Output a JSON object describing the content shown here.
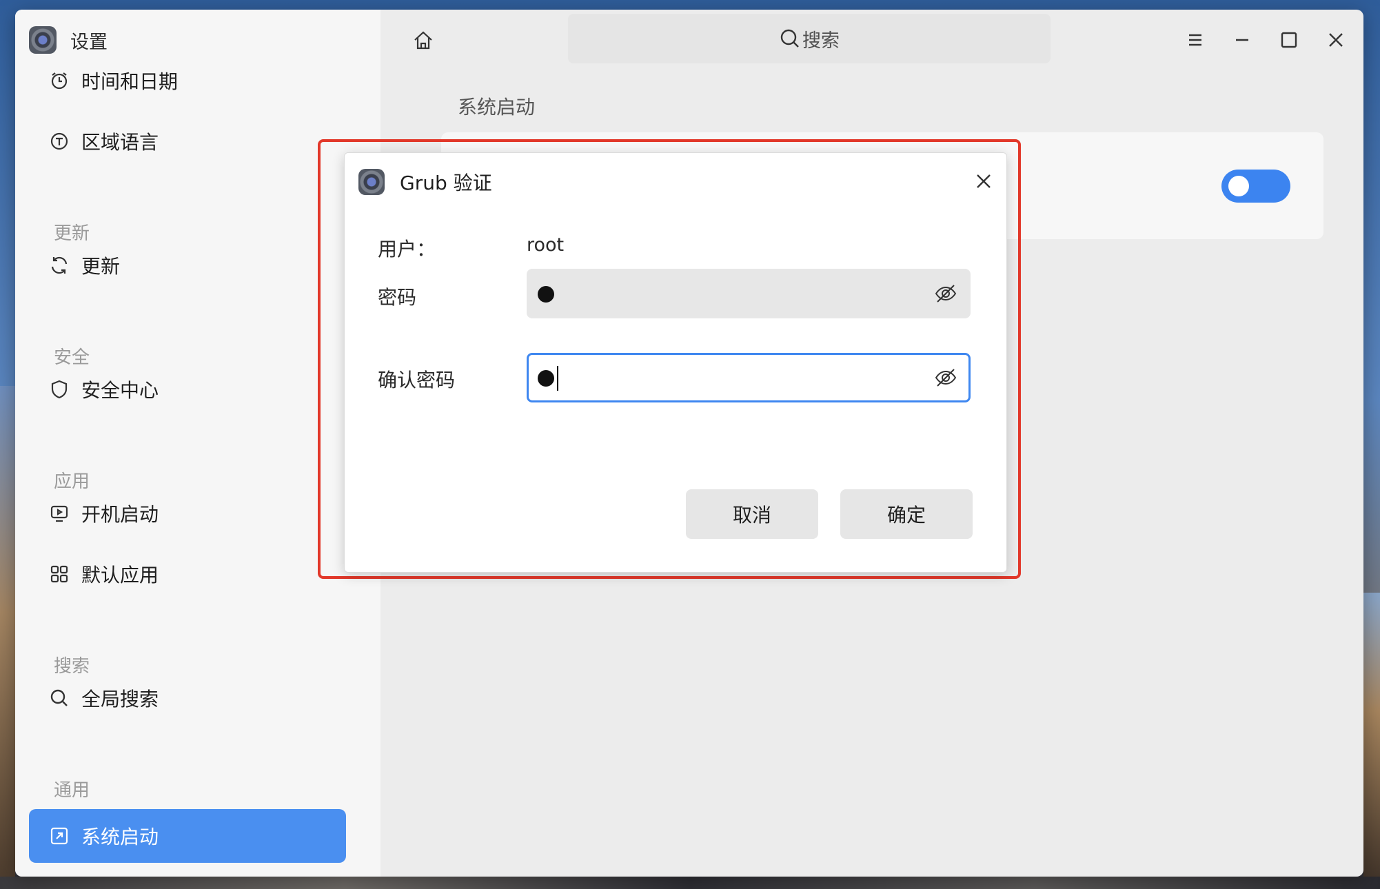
{
  "app": {
    "title": "设置"
  },
  "sidebar": {
    "items": [
      {
        "label": "时间和日期",
        "icon": "clock-icon"
      },
      {
        "label": "区域语言",
        "icon": "language-icon"
      },
      {
        "section": "更新"
      },
      {
        "label": "更新",
        "icon": "refresh-icon"
      },
      {
        "section": "安全"
      },
      {
        "label": "安全中心",
        "icon": "shield-icon"
      },
      {
        "section": "应用"
      },
      {
        "label": "开机启动",
        "icon": "autostart-icon"
      },
      {
        "label": "默认应用",
        "icon": "grid-icon"
      },
      {
        "section": "搜索"
      },
      {
        "label": "全局搜索",
        "icon": "search-icon"
      },
      {
        "section": "通用"
      },
      {
        "label": "系统启动",
        "icon": "boot-icon",
        "active": true
      }
    ]
  },
  "titlebar": {
    "search_placeholder": "搜索",
    "buttons": [
      "menu-icon",
      "minimize-icon",
      "maximize-icon",
      "close-icon"
    ]
  },
  "content": {
    "section_title": "系统启动",
    "toggle_on": true
  },
  "dialog": {
    "title": "Grub 验证",
    "user_label": "用户：",
    "user_value": "root",
    "password_label": "密码",
    "confirm_label": "确认密码",
    "cancel_label": "取消",
    "ok_label": "确定"
  },
  "colors": {
    "accent": "#4a8ff0",
    "toggle": "#3c84f0",
    "highlight": "#e2382a",
    "focus": "#3e87f0"
  }
}
